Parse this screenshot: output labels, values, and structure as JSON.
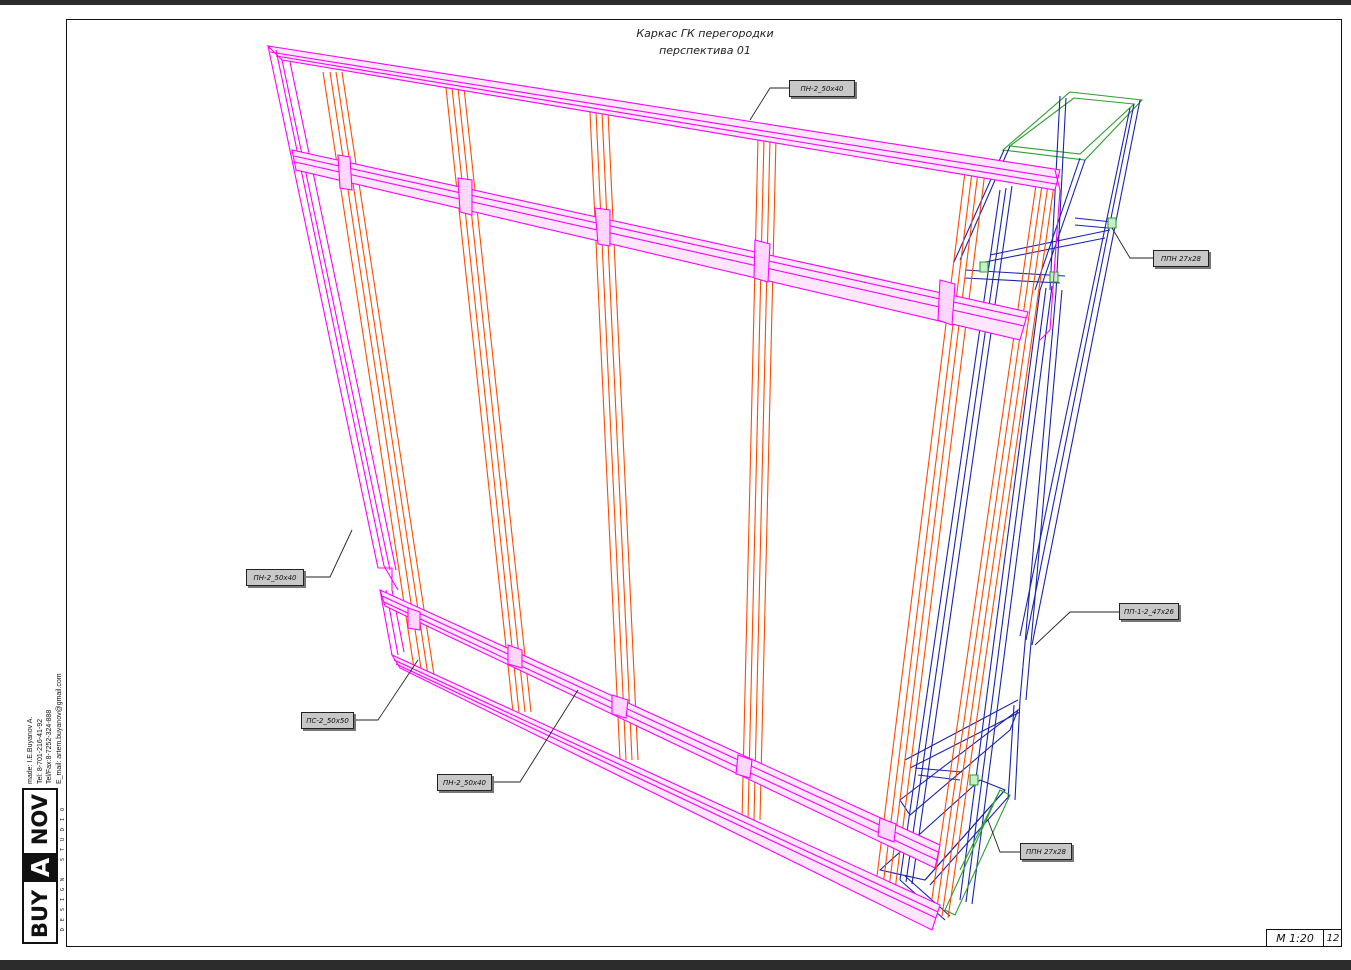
{
  "drawing": {
    "title_line1": "Каркас ГК перегородки",
    "title_line2": "перспектива 01",
    "scale": "М 1:20",
    "sheet": "12",
    "colors": {
      "guide_profile": "#ff00ff",
      "stud_profile": "#ff4a00",
      "ceiling_profile": "#1a23b0",
      "ceiling_guide": "#2ca02c",
      "frame": "#111111"
    }
  },
  "callouts": [
    {
      "label": "ПН-2_50х40"
    },
    {
      "label": "ППН 27х28"
    },
    {
      "label": "ПН-2_50х40"
    },
    {
      "label": "ПП-1-2_47х26"
    },
    {
      "label": "ПС-2_50х50"
    },
    {
      "label": "ПН-2_50х40"
    },
    {
      "label": "ППН 27х28"
    }
  ],
  "author": {
    "made": "made: I.E.Buyanov A.",
    "tel": "Tel: 8-701-216-41-92",
    "telfax": "Tel/Fax:8-7252-324-888",
    "email": "E_mail: artem.buyanov@gmail.com"
  },
  "logo": {
    "left": "BUY",
    "mid": "A",
    "right": "NOV",
    "sub": "DESIGN STUDIO"
  }
}
